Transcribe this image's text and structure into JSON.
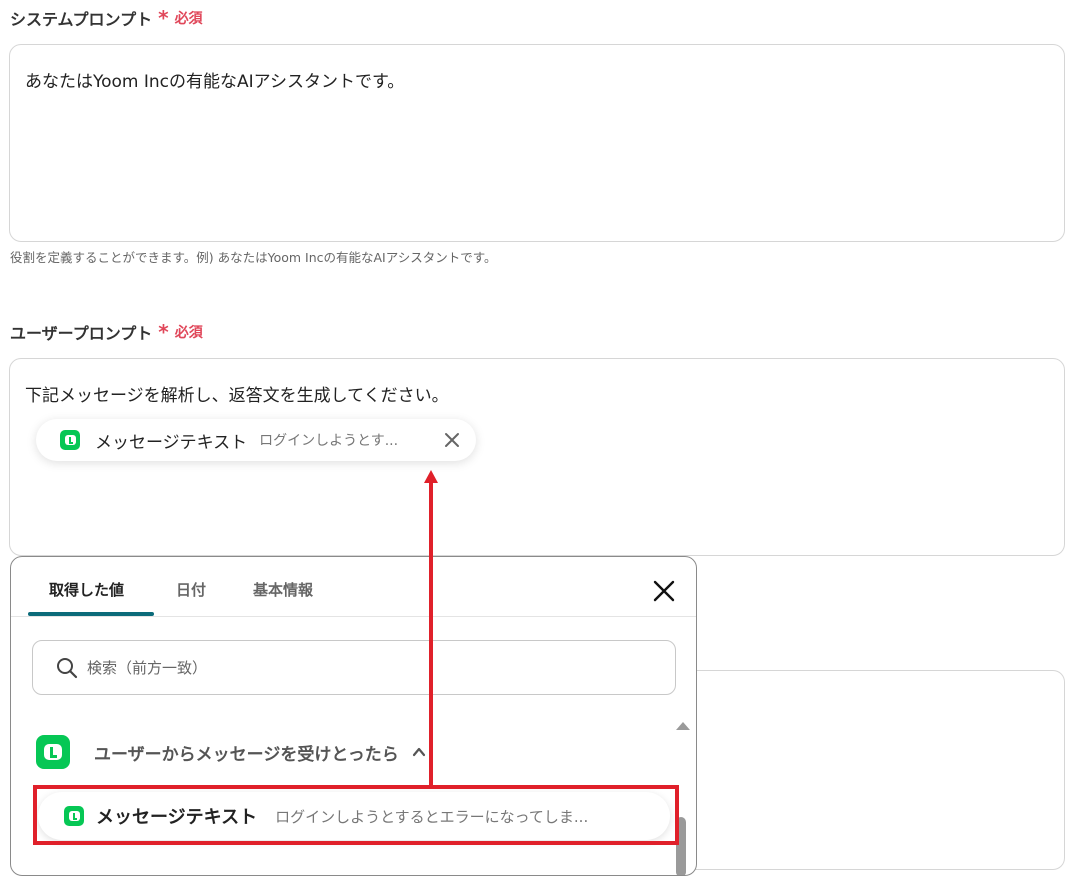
{
  "system_prompt": {
    "label": "システムプロンプト",
    "required_star": "*",
    "required_text": "必須",
    "value": "あなたはYoom Incの有能なAIアシスタントです。",
    "helper": "役割を定義することができます。例) あなたはYoom Incの有能なAIアシスタントです。"
  },
  "user_prompt": {
    "label": "ユーザープロンプト",
    "required_star": "*",
    "required_text": "必須",
    "value": "下記メッセージを解析し、返答文を生成してください。",
    "chip": {
      "icon": "line-icon",
      "label": "メッセージテキスト",
      "preview": "ログインしようとす..."
    }
  },
  "picker": {
    "tabs": [
      {
        "label": "取得した値",
        "active": true
      },
      {
        "label": "日付",
        "active": false
      },
      {
        "label": "基本情報",
        "active": false
      }
    ],
    "search_placeholder": "検索（前方一致）",
    "group": {
      "icon": "line-icon",
      "label": "ユーザーからメッセージを受けとったら",
      "expanded": true
    },
    "item": {
      "icon": "line-icon",
      "label": "メッセージテキスト",
      "preview": "ログインしようとするとエラーになってしま..."
    }
  },
  "colors": {
    "required": "#e0475a",
    "line_green": "#06c755",
    "tab_underline": "#0b6b7a",
    "annotation_red": "#e0202a"
  }
}
